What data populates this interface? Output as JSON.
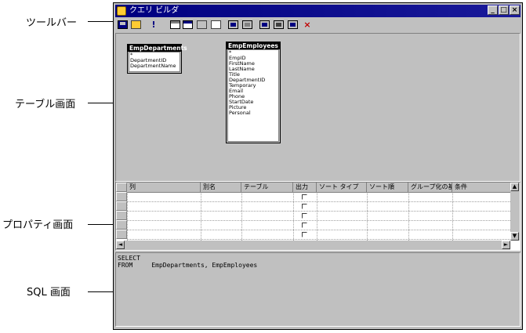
{
  "callouts": {
    "toolbar": "ツールバー",
    "table_pane": "テーブル画面",
    "property_pane": "プロパティ画面",
    "sql_pane": "SQL 画面"
  },
  "window": {
    "title": "クエリ ビルダ",
    "buttons": [
      "_",
      "□",
      "×"
    ]
  },
  "toolbar": {
    "exclaim": "!",
    "xmark": "×"
  },
  "tables": [
    {
      "name": "EmpDepartments",
      "fields": [
        "*",
        "DepartmentID",
        "DepartmentName"
      ]
    },
    {
      "name": "EmpEmployees",
      "fields": [
        "*",
        "EmpID",
        "FirstName",
        "LastName",
        "Title",
        "DepartmentID",
        "Temporary",
        "Email",
        "Phone",
        "StartDate",
        "Picture",
        "Personal"
      ]
    }
  ],
  "grid": {
    "columns": [
      "列",
      "別名",
      "テーブル",
      "出力",
      "ソート タイプ",
      "ソート順",
      "グループ化の基",
      "条件"
    ],
    "rows": 5,
    "scroll_up": "▲",
    "scroll_down": "▼",
    "scroll_left": "◄",
    "scroll_right": "►"
  },
  "sql": {
    "line1": "SELECT",
    "line2": "FROM     EmpDepartments, EmpEmployees"
  }
}
